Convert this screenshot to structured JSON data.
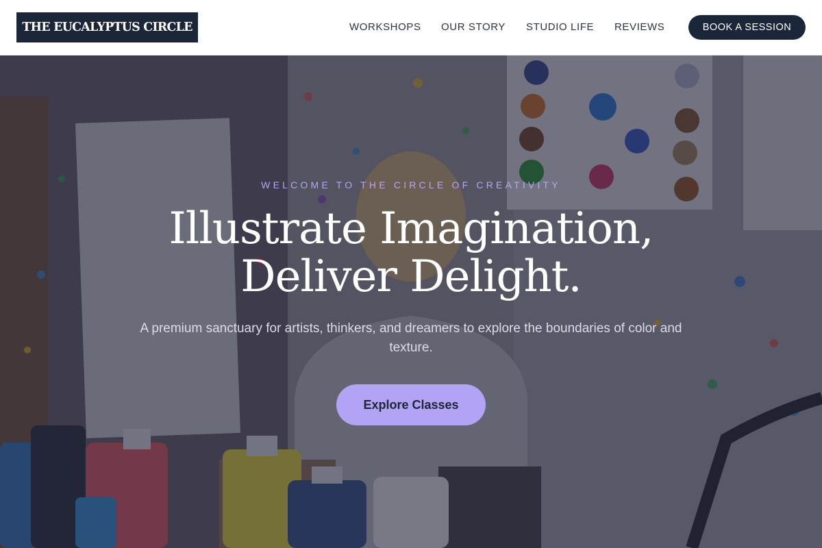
{
  "brand": {
    "name": "THE EUCALYPTUS CIRCLE"
  },
  "nav": {
    "items": [
      {
        "label": "WORKSHOPS"
      },
      {
        "label": "OUR STORY"
      },
      {
        "label": "STUDIO LIFE"
      },
      {
        "label": "REVIEWS"
      }
    ],
    "cta_label": "BOOK A SESSION"
  },
  "hero": {
    "eyebrow": "WELCOME TO THE CIRCLE OF CREATIVITY",
    "headline_line1": "Illustrate Imagination,",
    "headline_line2": "Deliver Delight.",
    "subtext": "A premium sanctuary for artists, thinkers, and dreamers to explore the boundaries of color and texture.",
    "cta_label": "Explore Classes",
    "background": "paint-splattered-art-studio-photo"
  },
  "colors": {
    "navy": "#1c2639",
    "accent_lavender": "#b3a3f5",
    "eyebrow_lavender": "#b7a6f0"
  }
}
